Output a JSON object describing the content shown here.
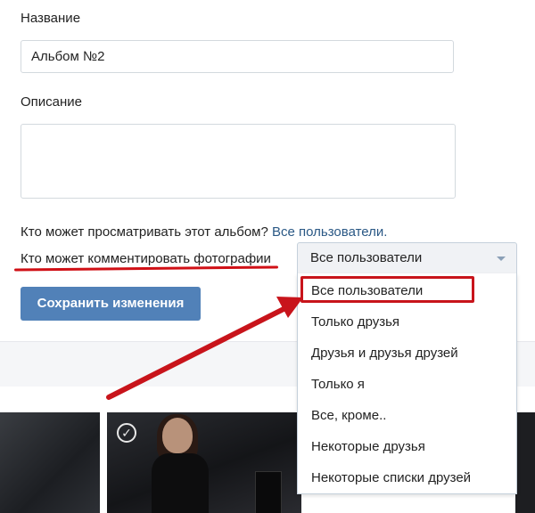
{
  "form": {
    "name_label": "Название",
    "name_value": "Альбом №2",
    "description_label": "Описание",
    "view_question": "Кто может просматривать этот альбом?",
    "view_value": "Все пользователи.",
    "comment_question": "Кто может комментировать фотографии",
    "save_label": "Сохранить изменения"
  },
  "select": {
    "value": "Все пользователи",
    "options": [
      "Все пользователи",
      "Только друзья",
      "Друзья и друзья друзей",
      "Только я",
      "Все, кроме..",
      "Некоторые друзья",
      "Некоторые списки друзей"
    ],
    "highlighted_index": 0
  },
  "colors": {
    "button": "#5181b8",
    "link": "#2a5885",
    "annotation_red": "#c8141b"
  },
  "icons": {
    "dropdown": "chevron-down-icon",
    "photo_check": "checkmark-icon"
  }
}
